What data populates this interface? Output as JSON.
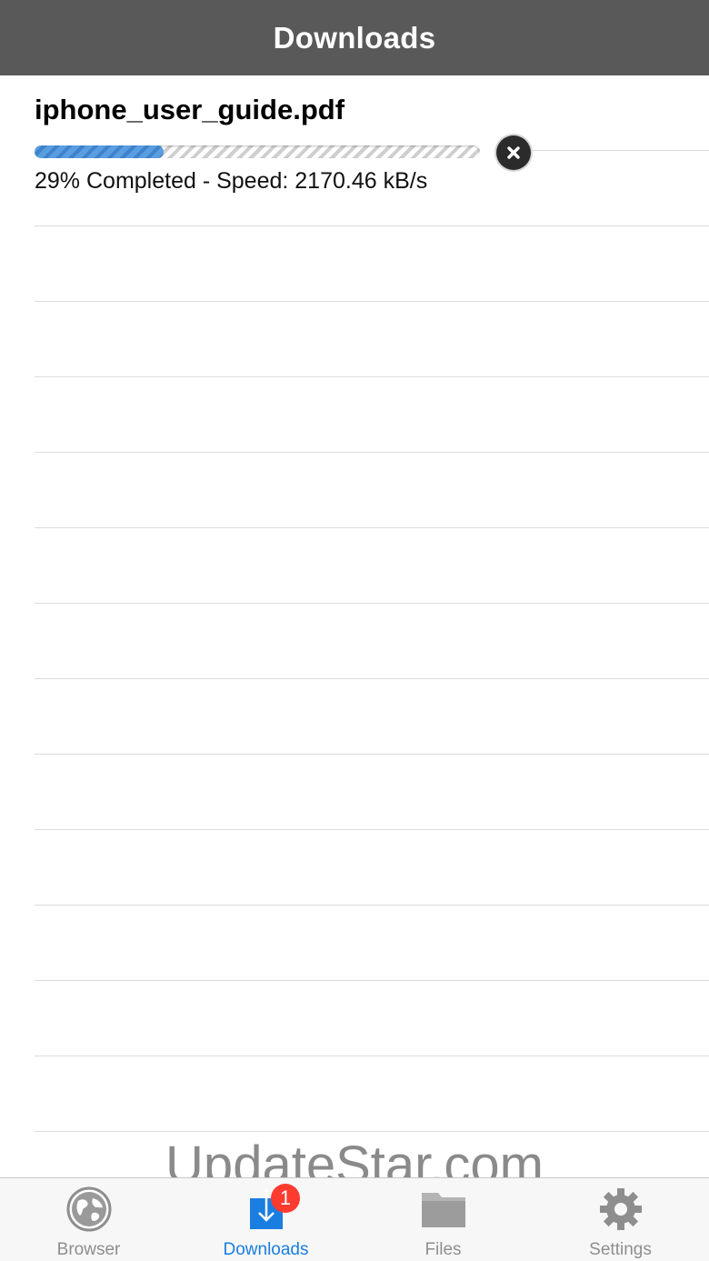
{
  "nav": {
    "title": "Downloads"
  },
  "download": {
    "file_name": "iphone_user_guide.pdf",
    "progress_fraction": 0.29,
    "status_text": "29% Completed - Speed: 2170.46 kB/s",
    "cancel_icon": "close-icon"
  },
  "watermark": {
    "text": "UpdateStar.com"
  },
  "tabs": [
    {
      "label": "Browser",
      "icon": "globe-icon",
      "active": false
    },
    {
      "label": "Downloads",
      "icon": "download-icon",
      "active": true,
      "badge": "1"
    },
    {
      "label": "Files",
      "icon": "folder-icon",
      "active": false
    },
    {
      "label": "Settings",
      "icon": "gear-icon",
      "active": false
    }
  ],
  "colors": {
    "nav_bar": "#595959",
    "progress_fill": "#4a90d9",
    "tab_active": "#1a7ee0",
    "tab_inactive": "#8e8e8e",
    "badge": "#ff3b30"
  }
}
